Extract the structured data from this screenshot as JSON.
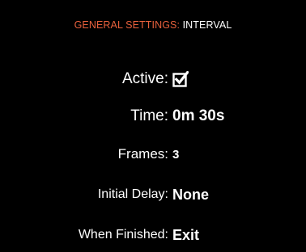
{
  "header": {
    "category": "GENERAL SETTINGS:",
    "section": "INTERVAL"
  },
  "settings": {
    "active": {
      "label": "Active:",
      "checked": true,
      "icon": "checked-checkbox-icon"
    },
    "time": {
      "label": "Time:",
      "value": "0m 30s"
    },
    "frames": {
      "label": "Frames:",
      "value": "3"
    },
    "initial_delay": {
      "label": "Initial Delay:",
      "value": "None"
    },
    "when_finished": {
      "label": "When Finished:",
      "value": "Exit"
    }
  },
  "colors": {
    "background": "#000000",
    "accent": "#e8603c",
    "text": "#ffffff"
  }
}
